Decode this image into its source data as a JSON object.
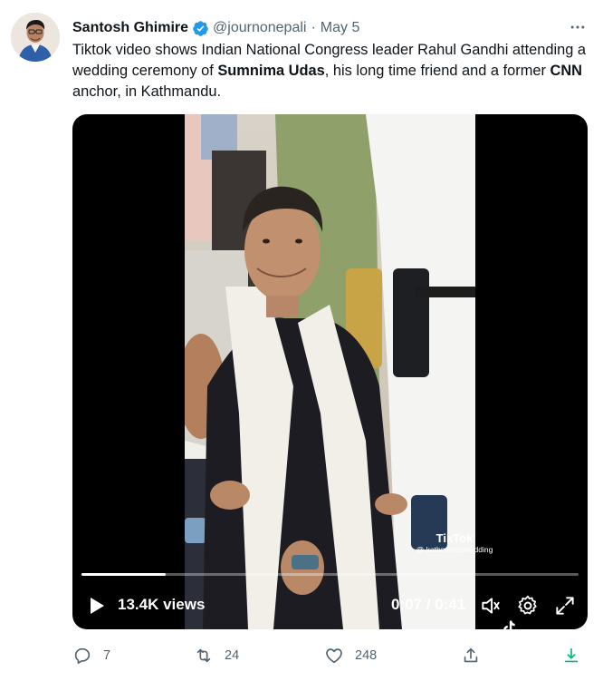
{
  "tweet": {
    "author_name": "Santosh Ghimire",
    "handle": "@journonepali",
    "separator": "·",
    "date": "May 5",
    "text_parts": [
      "Tiktok video shows Indian National Congress leader  Rahul Gandhi attending a wedding ceremony of ",
      "Sumnima Udas",
      ", his long time friend and a former ",
      "CNN",
      " anchor, in Kathmandu."
    ]
  },
  "video": {
    "views": "13.4K views",
    "time": "0:07 / 0:41",
    "progress": 0.17,
    "watermark_logo": "TikTok",
    "watermark_handle": "@ kathmanduwedding"
  },
  "actions": {
    "replies": "7",
    "retweets": "24",
    "likes": "248"
  },
  "icons": {
    "verified": "verified-badge-icon",
    "more": "more-dots-icon",
    "play": "play-icon",
    "volume": "volume-icon",
    "settings": "gear-icon",
    "fullscreen": "fullscreen-icon",
    "reply": "reply-icon",
    "retweet": "retweet-icon",
    "like": "heart-icon",
    "share": "share-icon",
    "download": "download-icon"
  },
  "colors": {
    "verified": "#1d9bf0",
    "secondary_text": "#536471",
    "download_accent": "#00ba7c"
  }
}
